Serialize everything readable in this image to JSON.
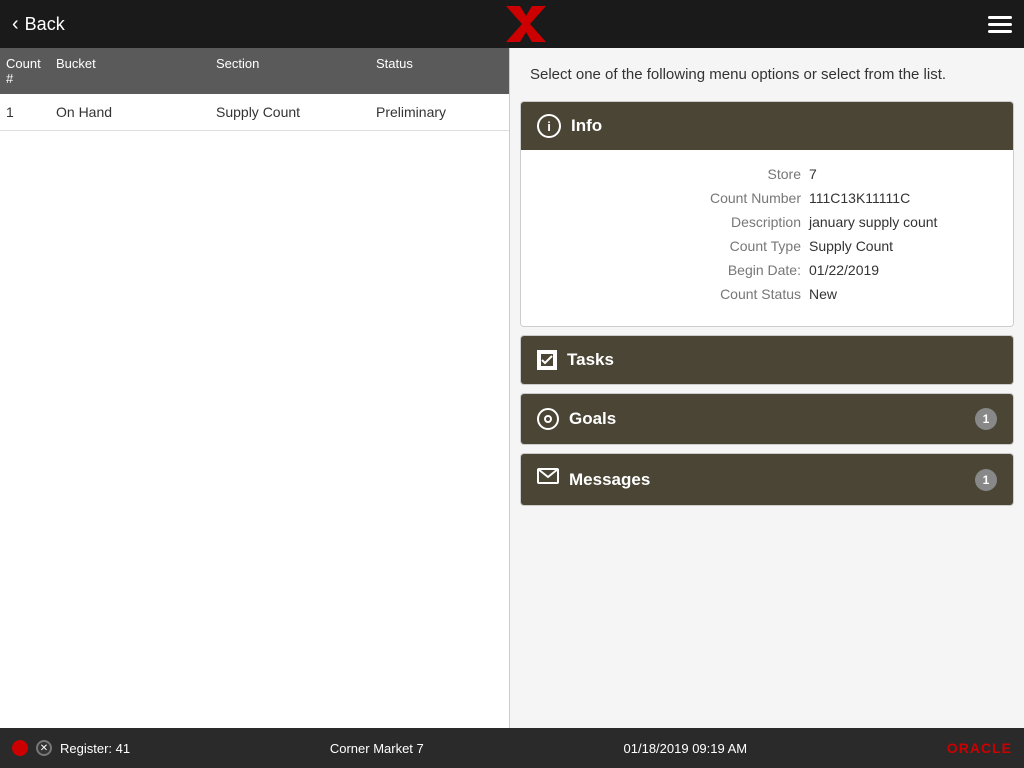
{
  "header": {
    "back_label": "Back",
    "menu_label": "Menu"
  },
  "left_panel": {
    "columns": {
      "count": "Count #",
      "bucket": "Bucket",
      "section": "Section",
      "status": "Status"
    },
    "rows": [
      {
        "count": "1",
        "bucket": "On Hand",
        "section": "Supply Count",
        "status": "Preliminary"
      }
    ]
  },
  "right_panel": {
    "instruction": "Select one of the following menu options or select from the list.",
    "info": {
      "title": "Info",
      "fields": {
        "store_label": "Store",
        "store_value": "7",
        "count_number_label": "Count Number",
        "count_number_value": "111C13K11111C",
        "description_label": "Description",
        "description_value": "january supply count",
        "count_type_label": "Count Type",
        "count_type_value": "Supply Count",
        "begin_date_label": "Begin Date:",
        "begin_date_value": "01/22/2019",
        "count_status_label": "Count Status",
        "count_status_value": "New"
      }
    },
    "tasks": {
      "title": "Tasks"
    },
    "goals": {
      "title": "Goals",
      "badge": "1"
    },
    "messages": {
      "title": "Messages",
      "badge": "1"
    }
  },
  "footer": {
    "register": "Register: 41",
    "store": "Corner Market 7",
    "datetime": "01/18/2019 09:19 AM",
    "oracle": "ORACLE"
  }
}
